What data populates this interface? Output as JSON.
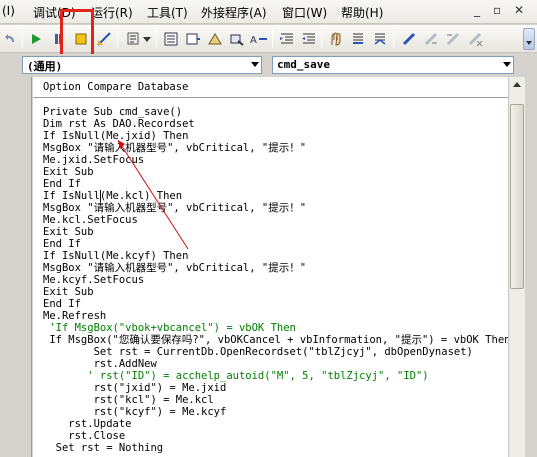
{
  "menubar": {
    "items": [
      "(I)",
      "调试(D)",
      "运行(R)",
      "工具(T)",
      "外接程序(A)",
      "窗口(W)",
      "帮助(H)"
    ],
    "window_buttons": [
      "_",
      "▫",
      "✕"
    ]
  },
  "combo": {
    "object_value": "(通用)",
    "procedure_value": "cmd_save"
  },
  "code": {
    "header": "Option Compare Database",
    "lines": [
      "Private Sub cmd_save()",
      "Dim rst As DAO.Recordset",
      "If IsNull(Me.jxid) Then",
      "MsgBox \"请输入机器型号\", vbCritical, \"提示！\"",
      "Me.jxid.SetFocus",
      "Exit Sub",
      "End If",
      "If IsNull(Me.kcl) Then",
      "MsgBox \"请输入机器型号\", vbCritical, \"提示！\"",
      "Me.kcl.SetFocus",
      "Exit Sub",
      "End If",
      "If IsNull(Me.kcyf) Then",
      "MsgBox \"请输入机器型号\", vbCritical, \"提示！\"",
      "Me.kcyf.SetFocus",
      "Exit Sub",
      "End If",
      "Me.Refresh",
      " 'If MsgBox(\"vbok+vbcancel\") = vbOK Then",
      " If MsgBox(\"您确认要保存吗?\", vbOKCancel + vbInformation, \"提示\") = vbOK Then",
      "        Set rst = CurrentDb.OpenRecordset(\"tblZjcyj\", dbOpenDynaset)",
      "        rst.AddNew",
      "       ' rst(\"ID\") = acchelp_autoid(\"M\", 5, \"tblZjcyj\", \"ID\")",
      "        rst(\"jxid\") = Me.jxid",
      "        rst(\"kcl\") = Me.kcl",
      "        rst(\"kcyf\") = Me.kcyf",
      "    rst.Update",
      "    rst.Close",
      "  Set rst = Nothing"
    ]
  },
  "colors": {
    "highlight_box": "#e2231a",
    "arrow": "#d01010",
    "comment": "#008000"
  }
}
